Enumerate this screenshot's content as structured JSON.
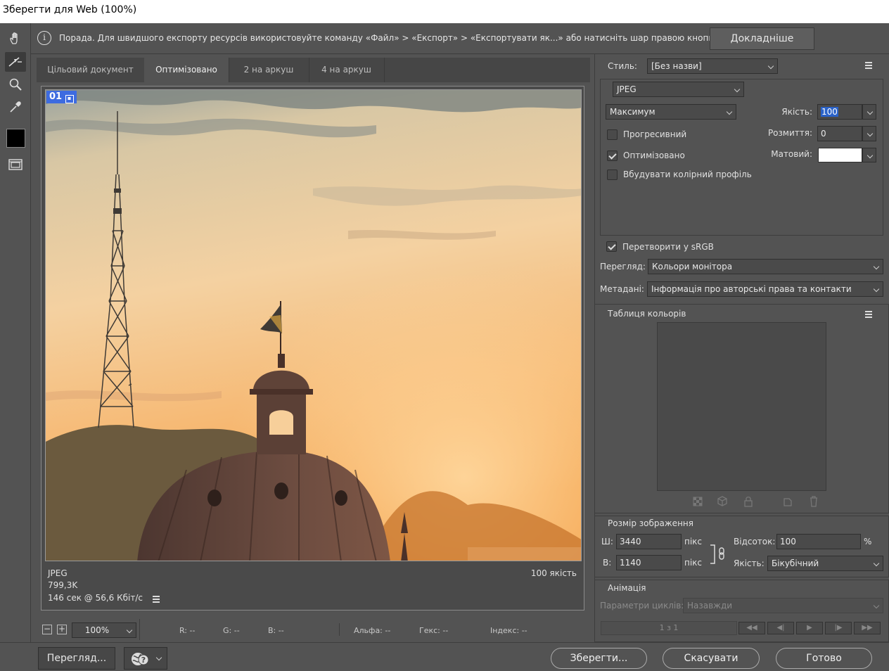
{
  "window": {
    "title": "Зберегти для Web (100%)"
  },
  "tip": {
    "text": "Порада. Для швидшого експорту ресурсів використовуйте команду «Файл» > «Експорт» > «Експортувати як...» або натисніть шар правою кнопкою миші.",
    "more_button": "Докладніше"
  },
  "tabs": [
    "Цільовий документ",
    "Оптимізовано",
    "2 на аркуш",
    "4 на аркуш"
  ],
  "canvas": {
    "badge": "01",
    "info_format": "JPEG",
    "info_size": "799,3K",
    "info_time": "146 сек @ 56,6 Кбіт/с",
    "info_quality": "100 якість"
  },
  "status": {
    "zoom": "100%",
    "r": "R: --",
    "g": "G: --",
    "b": "B: --",
    "alpha": "Альфа: --",
    "hex": "Гекс: --",
    "index": "Індекс: --"
  },
  "settings": {
    "style_label": "Стиль:",
    "style_value": "[Без назви]",
    "format": "JPEG",
    "quality_preset": "Максимум",
    "quality_label": "Якість:",
    "quality_value": "100",
    "blur_label": "Розмиття:",
    "blur_value": "0",
    "matte_label": "Матовий:",
    "matte_color": "#ffffff",
    "progressive": "Прогресивний",
    "progressive_checked": false,
    "optimized": "Оптимізовано",
    "optimized_checked": true,
    "embed_profile": "Вбудувати колірний профіль",
    "embed_profile_checked": false,
    "convert_srgb": "Перетворити у sRGB",
    "convert_srgb_checked": true,
    "preview_label": "Перегляд:",
    "preview_value": "Кольори монітора",
    "metadata_label": "Метадані:",
    "metadata_value": "Інформація про авторські права та контакти"
  },
  "color_table": {
    "title": "Таблиця кольорів"
  },
  "image_size": {
    "title": "Розмір зображення",
    "w_label": "Ш:",
    "w_value": "3440",
    "w_unit": "пікс",
    "h_label": "В:",
    "h_value": "1140",
    "h_unit": "пікс",
    "percent_label": "Відсоток:",
    "percent_value": "100",
    "percent_unit": "%",
    "quality_label": "Якість:",
    "quality_value": "Бікубічний"
  },
  "animation": {
    "title": "Анімація",
    "loop_label": "Параметри циклів:",
    "loop_value": "Назавжди",
    "frame_counter": "1 з 1"
  },
  "footer": {
    "preview_button": "Перегляд...",
    "save_button": "Зберегти...",
    "cancel_button": "Скасувати",
    "done_button": "Готово"
  }
}
